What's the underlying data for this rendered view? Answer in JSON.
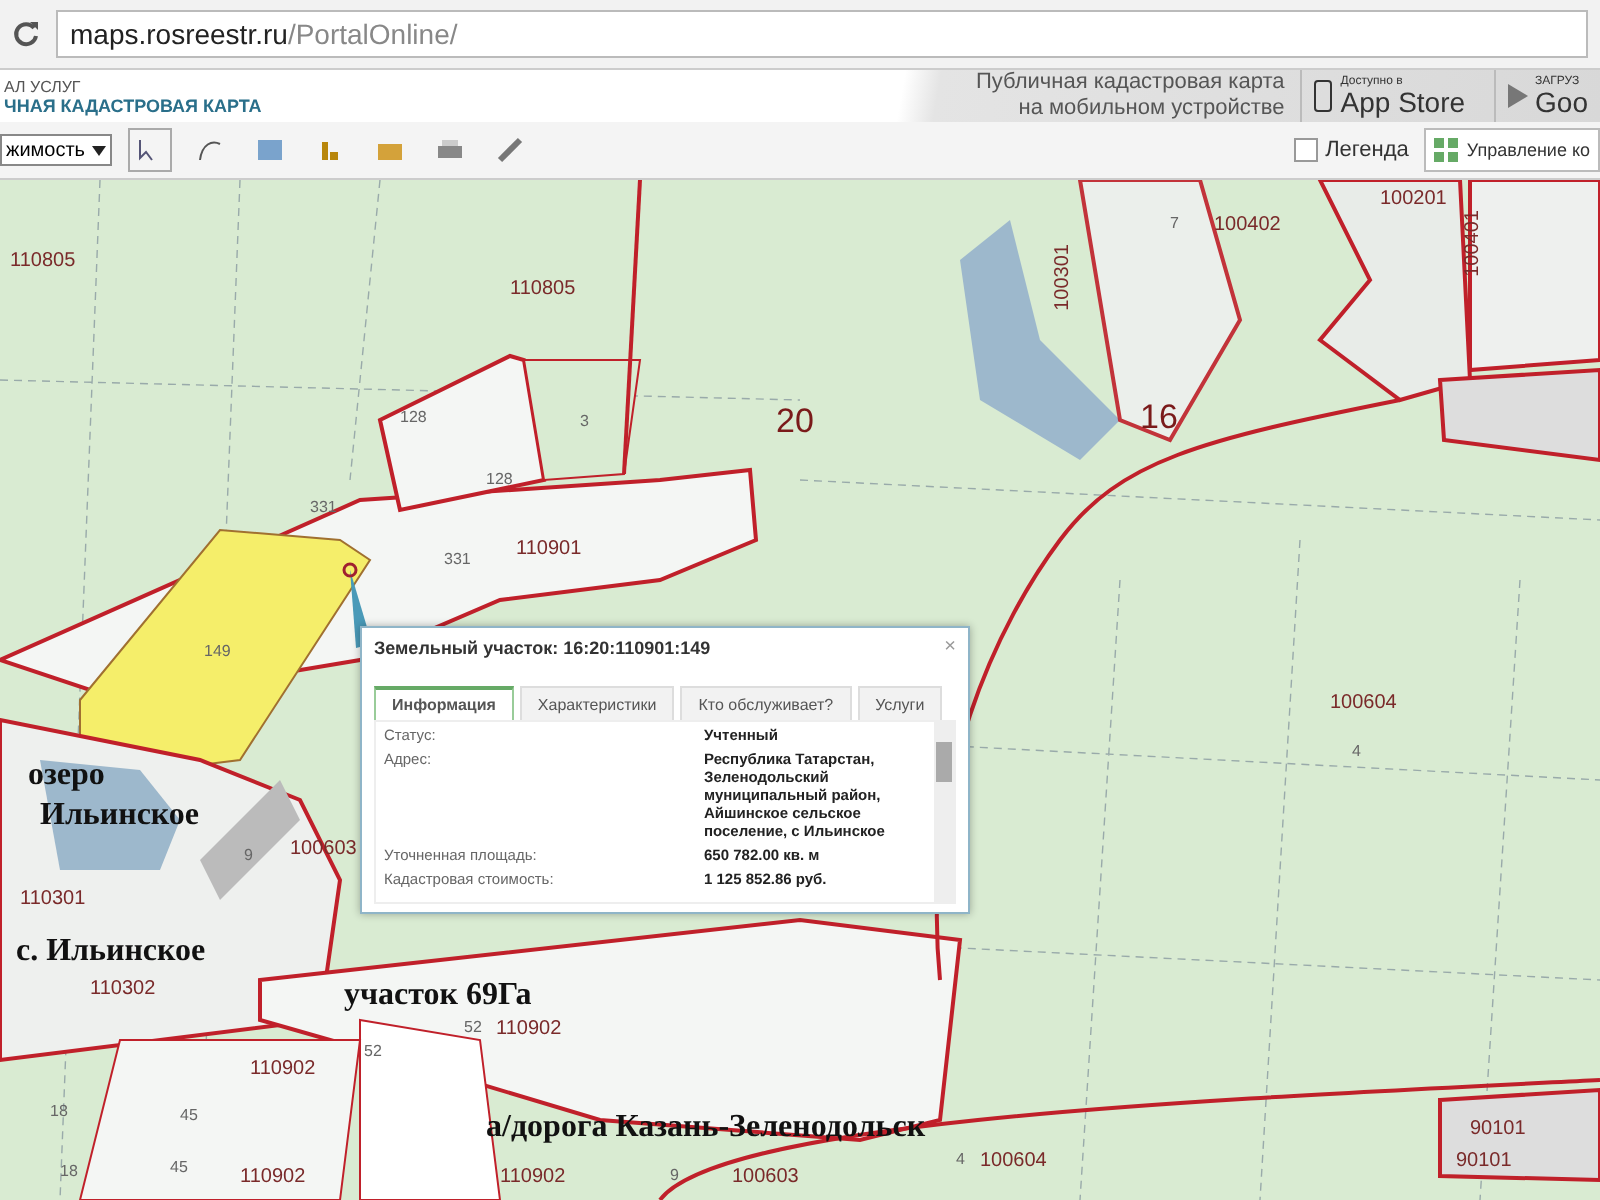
{
  "browser": {
    "host": "maps.rosreestr.ru",
    "path": "/PortalOnline/"
  },
  "header": {
    "line_1": "АЛ УСЛУГ",
    "line_2": "ЧНАЯ КАДАСТРОВАЯ КАРТА",
    "promo": "Публичная кадастровая карта на мобильном устройстве",
    "app_store": {
      "caption": "Доступно в",
      "name": "App Store"
    },
    "google_play": {
      "caption": "ЗАГРУЗ",
      "name": "Goo"
    }
  },
  "toolbar": {
    "select": "жимость",
    "legend": {
      "label": "Легенда",
      "checked": false
    },
    "manage_button": "Управление ко"
  },
  "map_labels": [
    {
      "text": "110805",
      "kind": "quarter"
    },
    {
      "text": "110805",
      "kind": "quarter"
    },
    {
      "text": "128",
      "kind": "number"
    },
    {
      "text": "3",
      "kind": "number"
    },
    {
      "text": "128",
      "kind": "number"
    },
    {
      "text": "331",
      "kind": "number"
    },
    {
      "text": "331",
      "kind": "number"
    },
    {
      "text": "110901",
      "kind": "quarter"
    },
    {
      "text": "20",
      "kind": "district"
    },
    {
      "text": "149",
      "kind": "number"
    },
    {
      "text": "7",
      "kind": "number"
    },
    {
      "text": "100402",
      "kind": "quarter"
    },
    {
      "text": "100201",
      "kind": "quarter"
    },
    {
      "text": "100401",
      "kind": "quarter"
    },
    {
      "text": "100301",
      "kind": "quarter"
    },
    {
      "text": "16",
      "kind": "district"
    },
    {
      "text": "100604",
      "kind": "quarter"
    },
    {
      "text": "4",
      "kind": "number"
    },
    {
      "text": "озеро",
      "kind": "caption"
    },
    {
      "text": "Ильинское",
      "kind": "caption"
    },
    {
      "text": "9",
      "kind": "number"
    },
    {
      "text": "100603",
      "kind": "quarter"
    },
    {
      "text": "110301",
      "kind": "quarter"
    },
    {
      "text": "с. Ильинское",
      "kind": "caption"
    },
    {
      "text": "110302",
      "kind": "quarter"
    },
    {
      "text": "участок 69Га",
      "kind": "caption"
    },
    {
      "text": "52",
      "kind": "number"
    },
    {
      "text": "110902",
      "kind": "quarter"
    },
    {
      "text": "52",
      "kind": "number"
    },
    {
      "text": "110902",
      "kind": "quarter"
    },
    {
      "text": "18",
      "kind": "number"
    },
    {
      "text": "45",
      "kind": "number"
    },
    {
      "text": "а/дорога Казань-Зеленодольск",
      "kind": "caption"
    },
    {
      "text": "18",
      "kind": "number"
    },
    {
      "text": "45",
      "kind": "number"
    },
    {
      "text": "110902",
      "kind": "quarter"
    },
    {
      "text": "110902",
      "kind": "quarter"
    },
    {
      "text": "9",
      "kind": "number"
    },
    {
      "text": "100603",
      "kind": "quarter"
    },
    {
      "text": "4",
      "kind": "number"
    },
    {
      "text": "100604",
      "kind": "quarter"
    },
    {
      "text": "90101",
      "kind": "quarter"
    },
    {
      "text": "90101",
      "kind": "quarter"
    }
  ],
  "popup": {
    "title": "Земельный участок: 16:20:110901:149",
    "close": "×",
    "tabs": [
      {
        "label": "Информация",
        "selected": true
      },
      {
        "label": "Характеристики",
        "selected": false
      },
      {
        "label": "Кто обслуживает?",
        "selected": false
      },
      {
        "label": "Услуги",
        "selected": false
      }
    ],
    "rows": [
      {
        "label": "Статус:",
        "value": "Учтенный"
      },
      {
        "label": "Адрес:",
        "value": "Республика Татарстан, Зеленодольский муниципальный район, Айшинское сельское поселение, с Ильинское"
      },
      {
        "label": "Уточненная площадь:",
        "value": "650 782.00 кв. м"
      },
      {
        "label": "Кадастровая стоимость:",
        "value": "1 125 852.86 руб."
      }
    ]
  }
}
